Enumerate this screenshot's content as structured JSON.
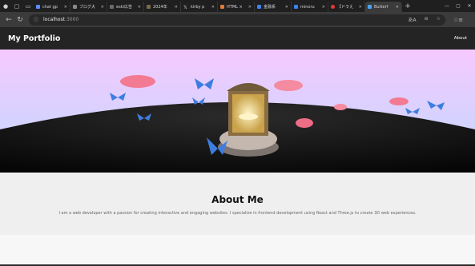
{
  "browser": {
    "tabs": [
      {
        "label": "chat gp",
        "color": "#5a8cff"
      },
      {
        "label": "ブログ大",
        "color": "#888888"
      },
      {
        "label": "eski広告",
        "color": "#6a6a6a"
      },
      {
        "label": "2024年",
        "color": "#7a6a4a"
      },
      {
        "label": "kirby p",
        "color": "#dddddd"
      },
      {
        "label": "HTML ×",
        "color": "#e07b39"
      },
      {
        "label": "金融系",
        "color": "#3b82f6"
      },
      {
        "label": "minoru",
        "color": "#3b82f6"
      },
      {
        "label": "【ドラえ",
        "color": "#e53935"
      },
      {
        "label": "Butterf",
        "color": "#4aa3ff",
        "active": true
      }
    ],
    "url_host": "localhost",
    "url_port": ":3000",
    "accent": "#3b3b3b"
  },
  "site": {
    "brand": "My Portfolio",
    "nav_link": "About"
  },
  "about": {
    "title": "About Me",
    "body": "I am a web developer with a passion for creating interactive and engaging websites. I specialize in frontend development using React and Three.js to create 3D web experiences."
  },
  "icons": {
    "back": "arrow-left-icon",
    "refresh": "refresh-icon",
    "info": "info-icon",
    "translate": "translate-icon",
    "zoom": "zoom-icon",
    "favorite": "star-icon",
    "favorites_bar": "favorites-icon"
  }
}
